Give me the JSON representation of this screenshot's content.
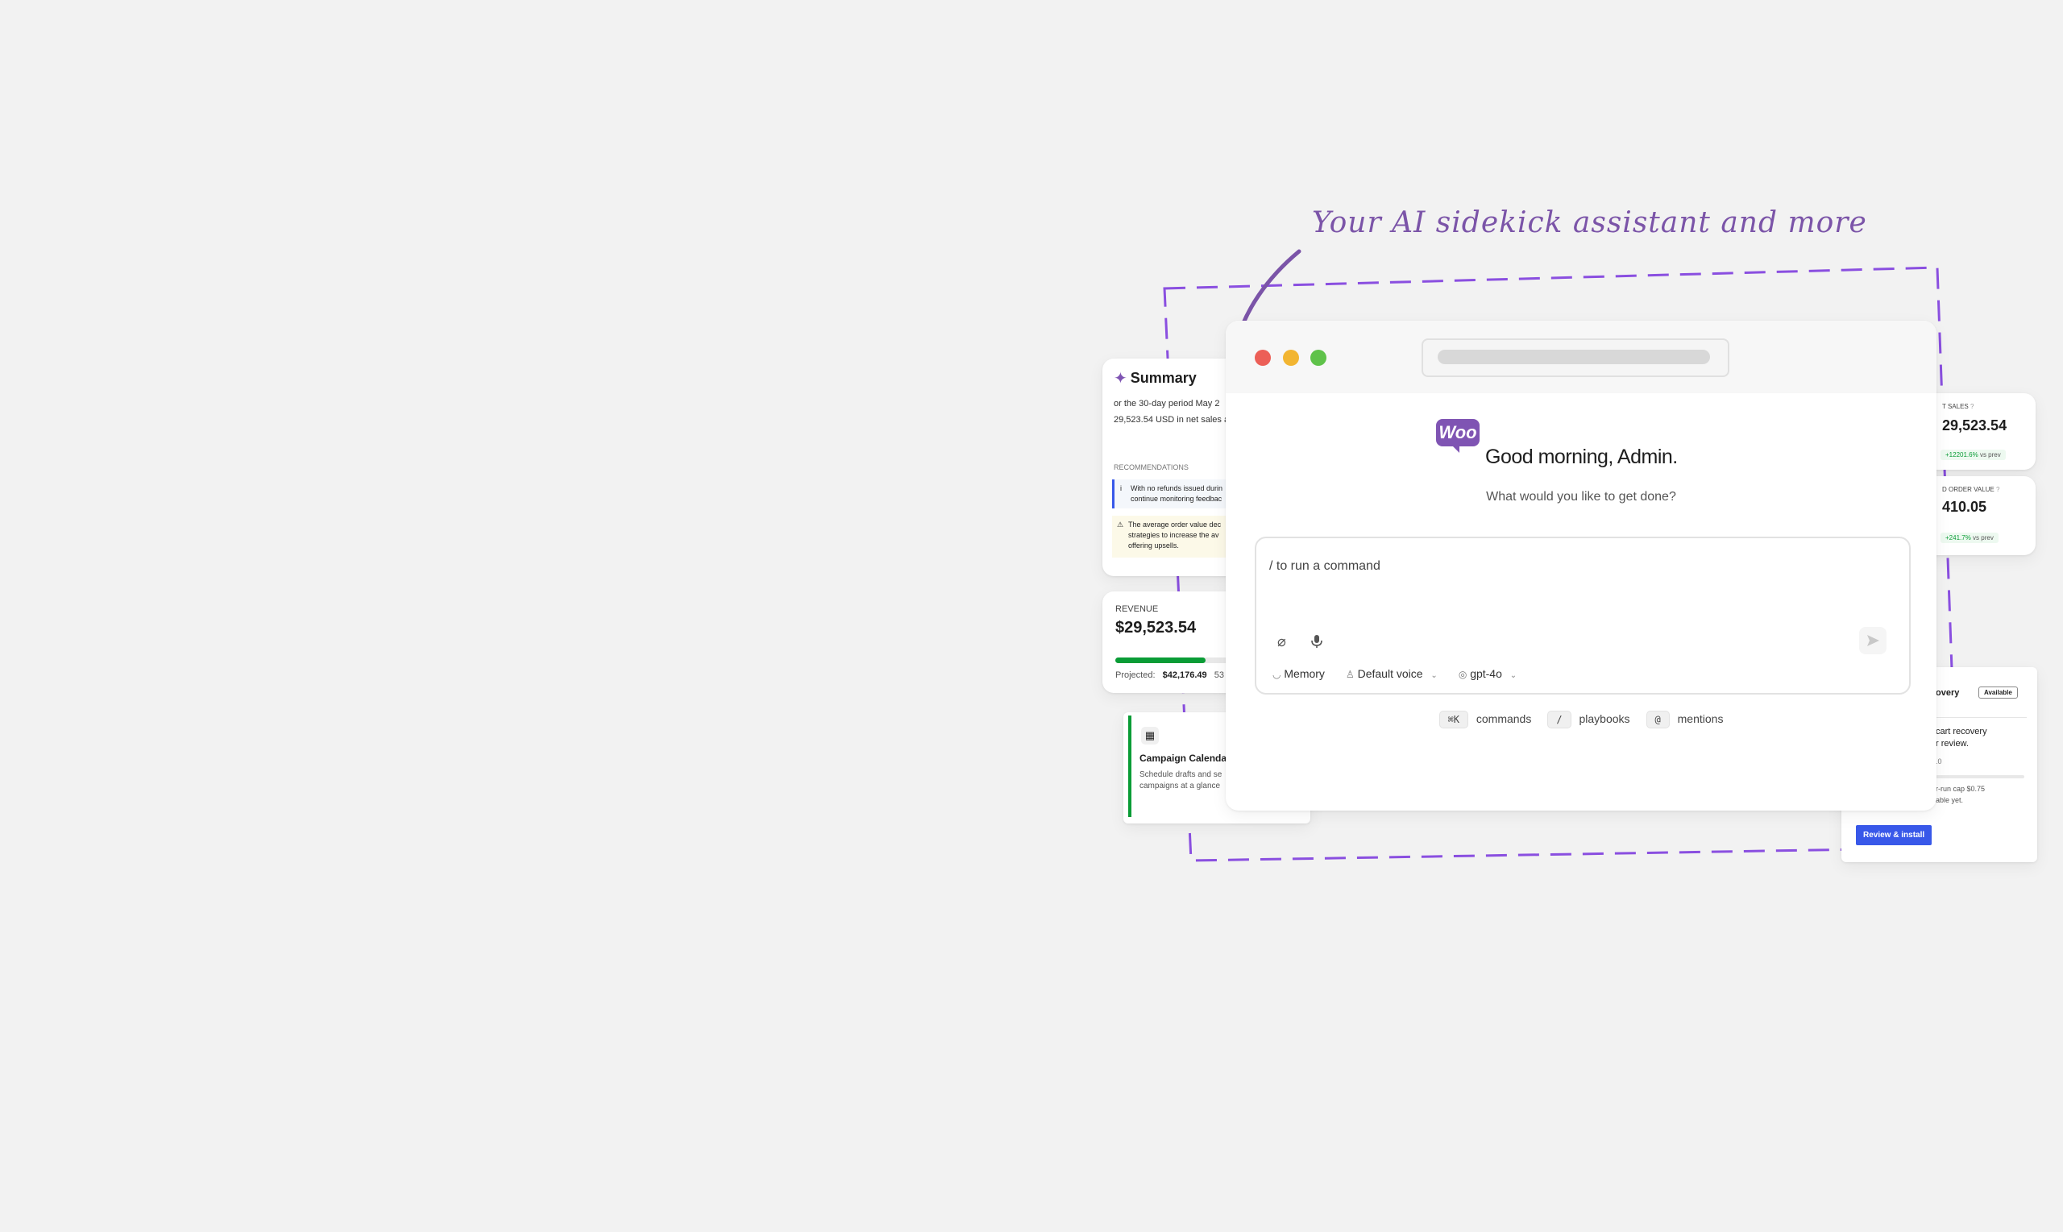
{
  "heading": "Your AI sidekick assistant and more",
  "colors": {
    "accent": "#7f54b3",
    "dash": "#8a4fe0",
    "primary_btn": "#3858e9",
    "green": "#0a9c36"
  },
  "summary_card": {
    "title": "Summary",
    "line1": "or the 30-day period May 2",
    "line2": "29,523.54 USD in net sales a",
    "rec_heading": "RECOMMENDATIONS",
    "rec1_a": "With no refunds issued durin",
    "rec1_b": "continue monitoring feedbac",
    "rec2_a": "The average order value dec",
    "rec2_b": "strategies to increase the av",
    "rec2_c": "offering upsells."
  },
  "revenue_card": {
    "label": "REVENUE",
    "value": "$29,523.54",
    "progress": 0.7,
    "projected_label": "Projected:",
    "projected_value": "$42,176.49",
    "projected_extra": "53"
  },
  "campaign_card": {
    "title": "Campaign Calendar",
    "desc1": "Schedule drafts and se",
    "desc2": "campaigns at a glance"
  },
  "net_sales_card": {
    "label": "T SALES",
    "value": "29,523.54",
    "delta": "+12201.6%",
    "vs": "vs prev"
  },
  "aov_card": {
    "label": "D ORDER VALUE",
    "value": "410.05",
    "delta": "+241.7%",
    "vs": "vs prev"
  },
  "recovery_card": {
    "title": "overy",
    "badge": "Available",
    "line1": "cart recovery",
    "line2": "r review.",
    "line3": ".0",
    "line4": "r-run cap $0.75",
    "line5": "able yet.",
    "button": "Review & install"
  },
  "main_window": {
    "logo": "Woo",
    "greeting": "Good morning, Admin.",
    "subtitle": "What would you like to get done?",
    "input_placeholder": "/ to run a command",
    "memory": "Memory",
    "voice": "Default voice",
    "model": "gpt-4o",
    "hints": [
      {
        "key": "⌘K",
        "label": "commands"
      },
      {
        "key": "/",
        "label": "playbooks"
      },
      {
        "key": "@",
        "label": "mentions"
      }
    ]
  }
}
